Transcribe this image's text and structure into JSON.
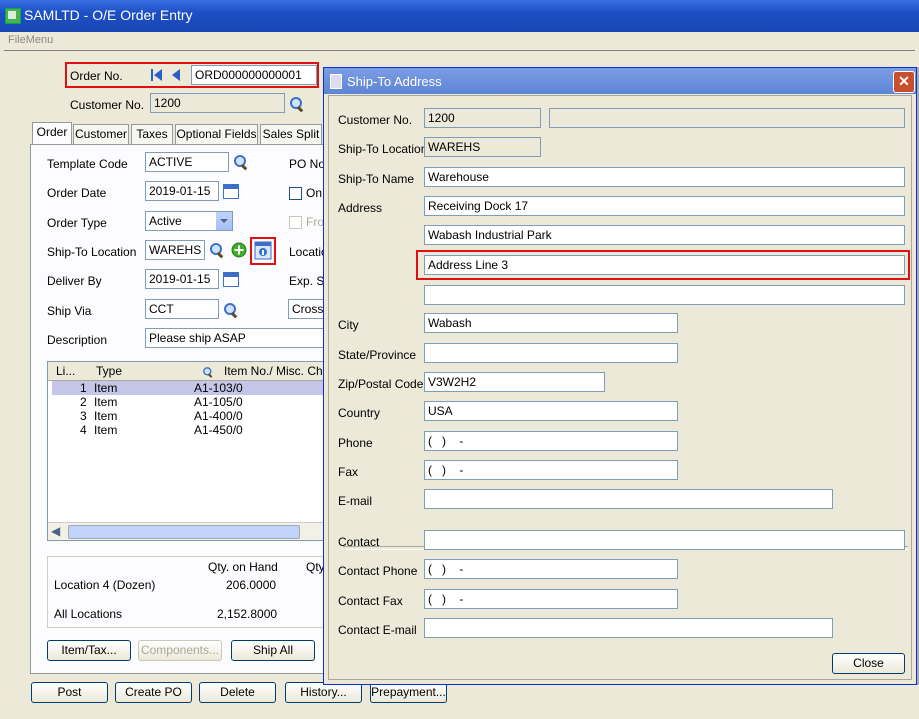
{
  "window": {
    "title": "SAMLTD - O/E Order Entry",
    "menu": "FileMenu"
  },
  "header": {
    "order_no_label": "Order No.",
    "order_no": "ORD000000000001",
    "customer_no_label": "Customer No.",
    "customer_no": "1200"
  },
  "tabs": [
    "Order",
    "Customer",
    "Taxes",
    "Optional Fields",
    "Sales Split"
  ],
  "order_form": {
    "template_code_label": "Template Code",
    "template_code": "ACTIVE",
    "order_date_label": "Order Date",
    "order_date": "2019-01-15",
    "order_type_label": "Order Type",
    "order_type": "Active",
    "ship_to_label": "Ship-To Location",
    "ship_to": "WAREHS",
    "deliver_by_label": "Deliver By",
    "deliver_by": "2019-01-15",
    "ship_via_label": "Ship Via",
    "ship_via": "CCT",
    "description_label": "Description",
    "description": "Please ship ASAP",
    "po_label": "PO No",
    "on_label": "On",
    "fro_label": "Fro",
    "location_label": "Locatio",
    "exp_label": "Exp. Sh",
    "cross_value": "Cross-"
  },
  "grid": {
    "headers": [
      "Li...",
      "Type",
      "Item No./ Misc. Char"
    ],
    "rows": [
      {
        "line": "1",
        "type": "Item",
        "item": "A1-103/0"
      },
      {
        "line": "2",
        "type": "Item",
        "item": "A1-105/0"
      },
      {
        "line": "3",
        "type": "Item",
        "item": "A1-400/0"
      },
      {
        "line": "4",
        "type": "Item",
        "item": "A1-450/0"
      }
    ]
  },
  "summary": {
    "qty_on_hand_label": "Qty. on Hand",
    "qty_label": "Qty",
    "location_label": "Location  4 (Dozen)",
    "location_qty": "206.0000",
    "all_locations_label": "All Locations",
    "all_locations_qty": "2,152.8000"
  },
  "buttons": {
    "item_tax": "Item/Tax...",
    "components": "Components...",
    "ship_all": "Ship All",
    "post": "Post",
    "create_po": "Create PO",
    "delete": "Delete",
    "history": "History...",
    "prepayment": "Prepayment..."
  },
  "dialog": {
    "title": "Ship-To Address",
    "fields": {
      "customer_no_label": "Customer No.",
      "customer_no": "1200",
      "ship_to_location_label": "Ship-To Location",
      "ship_to_location": "WAREHS",
      "ship_to_name_label": "Ship-To Name",
      "ship_to_name": "Warehouse",
      "address_label": "Address",
      "address1": "Receiving Dock 17",
      "address2": "Wabash Industrial Park",
      "address3": "Address Line 3",
      "address4": "",
      "city_label": "City",
      "city": "Wabash",
      "state_label": "State/Province",
      "state": "",
      "zip_label": "Zip/Postal Code",
      "zip": "V3W2H2",
      "country_label": "Country",
      "country": "USA",
      "phone_label": "Phone",
      "phone": "(   )    -",
      "fax_label": "Fax",
      "fax": "(   )    -",
      "email_label": "E-mail",
      "email": "",
      "contact_label": "Contact",
      "contact": "",
      "contact_phone_label": "Contact Phone",
      "contact_phone": "(   )    -",
      "contact_fax_label": "Contact Fax",
      "contact_fax": "(   )    -",
      "contact_email_label": "Contact E-mail",
      "contact_email": ""
    },
    "close_label": "Close"
  }
}
